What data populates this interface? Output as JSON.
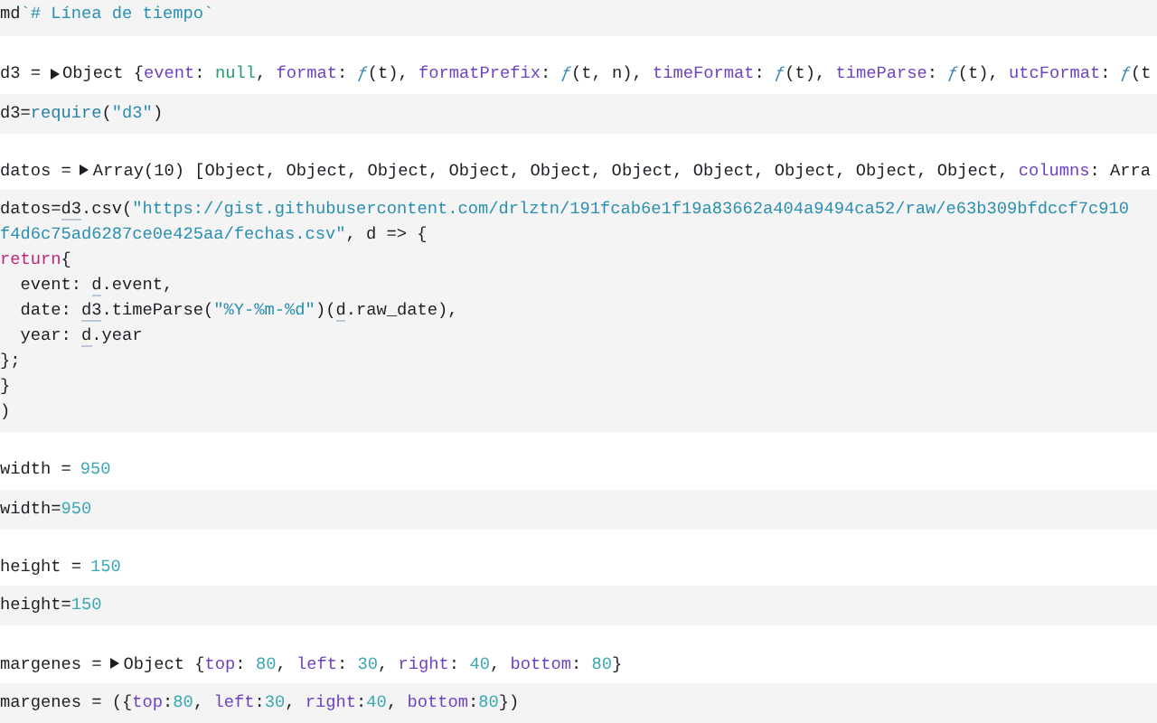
{
  "cells": [
    {
      "source": [
        [
          {
            "kind": "plain",
            "text": "md"
          },
          {
            "kind": "string",
            "text": "`# Línea de tiempo`"
          }
        ]
      ]
    },
    {
      "output": {
        "label": "d3 =",
        "expanded": false,
        "value": [
          {
            "kind": "plain",
            "text": "Object {"
          },
          {
            "kind": "property",
            "text": "event"
          },
          {
            "kind": "plain",
            "text": ": "
          },
          {
            "kind": "null",
            "text": "null"
          },
          {
            "kind": "plain",
            "text": ", "
          },
          {
            "kind": "property",
            "text": "format"
          },
          {
            "kind": "plain",
            "text": ": "
          },
          {
            "kind": "function",
            "text": "ƒ"
          },
          {
            "kind": "plain",
            "text": "(t), "
          },
          {
            "kind": "property",
            "text": "formatPrefix"
          },
          {
            "kind": "plain",
            "text": ": "
          },
          {
            "kind": "function",
            "text": "ƒ"
          },
          {
            "kind": "plain",
            "text": "(t, n), "
          },
          {
            "kind": "property",
            "text": "timeFormat"
          },
          {
            "kind": "plain",
            "text": ": "
          },
          {
            "kind": "function",
            "text": "ƒ"
          },
          {
            "kind": "plain",
            "text": "(t), "
          },
          {
            "kind": "property",
            "text": "timeParse"
          },
          {
            "kind": "plain",
            "text": ": "
          },
          {
            "kind": "function",
            "text": "ƒ"
          },
          {
            "kind": "plain",
            "text": "(t), "
          },
          {
            "kind": "property",
            "text": "utcFormat"
          },
          {
            "kind": "plain",
            "text": ": "
          },
          {
            "kind": "function",
            "text": "ƒ"
          },
          {
            "kind": "plain",
            "text": "(t"
          }
        ]
      },
      "source": [
        [
          {
            "kind": "plain",
            "text": "d3="
          },
          {
            "kind": "call",
            "text": "require"
          },
          {
            "kind": "plain",
            "text": "("
          },
          {
            "kind": "string",
            "text": "\"d3\""
          },
          {
            "kind": "plain",
            "text": ")"
          }
        ]
      ]
    },
    {
      "output": {
        "label": "datos =",
        "expanded": false,
        "value": [
          {
            "kind": "plain",
            "text": "Array(10) [Object, Object, Object, Object, Object, Object, Object, Object, Object, Object, "
          },
          {
            "kind": "property",
            "text": "columns"
          },
          {
            "kind": "plain",
            "text": ": Arra"
          }
        ]
      },
      "source": [
        [
          {
            "kind": "plain",
            "text": "datos="
          },
          {
            "kind": "reference",
            "text": "d3"
          },
          {
            "kind": "plain",
            "text": ".csv("
          },
          {
            "kind": "string",
            "text": "\"https://gist.githubusercontent.com/drlztn/191fcab6e1f19a83662a404a9494ca52/raw/e63b309bfdccf7c910"
          }
        ],
        [
          {
            "kind": "string",
            "text": "f4d6c75ad6287ce0e425aa/fechas.csv\""
          },
          {
            "kind": "plain",
            "text": ", d => {"
          }
        ],
        [
          {
            "kind": "keyword",
            "text": "return"
          },
          {
            "kind": "plain",
            "text": "{"
          }
        ],
        [
          {
            "kind": "plain",
            "text": "  event: "
          },
          {
            "kind": "reference",
            "text": "d"
          },
          {
            "kind": "plain",
            "text": ".event,"
          }
        ],
        [
          {
            "kind": "plain",
            "text": "  date: "
          },
          {
            "kind": "reference",
            "text": "d3"
          },
          {
            "kind": "plain",
            "text": ".timeParse("
          },
          {
            "kind": "string",
            "text": "\"%Y-%m-%d\""
          },
          {
            "kind": "plain",
            "text": ")("
          },
          {
            "kind": "reference",
            "text": "d"
          },
          {
            "kind": "plain",
            "text": ".raw_date),"
          }
        ],
        [
          {
            "kind": "plain",
            "text": "  year: "
          },
          {
            "kind": "reference",
            "text": "d"
          },
          {
            "kind": "plain",
            "text": ".year"
          }
        ],
        [
          {
            "kind": "plain",
            "text": "};"
          }
        ],
        [
          {
            "kind": "plain",
            "text": "}"
          }
        ],
        [
          {
            "kind": "plain",
            "text": ")"
          }
        ]
      ]
    },
    {
      "output": {
        "label": "width =",
        "value": [
          {
            "kind": "number",
            "text": "950"
          }
        ]
      },
      "source": [
        [
          {
            "kind": "plain",
            "text": "width="
          },
          {
            "kind": "number",
            "text": "950"
          }
        ]
      ]
    },
    {
      "output": {
        "label": "height =",
        "value": [
          {
            "kind": "number",
            "text": "150"
          }
        ]
      },
      "source": [
        [
          {
            "kind": "plain",
            "text": "height="
          },
          {
            "kind": "number",
            "text": "150"
          }
        ]
      ]
    },
    {
      "output": {
        "label": "margenes =",
        "expanded": false,
        "value": [
          {
            "kind": "plain",
            "text": "Object {"
          },
          {
            "kind": "property",
            "text": "top"
          },
          {
            "kind": "plain",
            "text": ": "
          },
          {
            "kind": "number",
            "text": "80"
          },
          {
            "kind": "plain",
            "text": ", "
          },
          {
            "kind": "property",
            "text": "left"
          },
          {
            "kind": "plain",
            "text": ": "
          },
          {
            "kind": "number",
            "text": "30"
          },
          {
            "kind": "plain",
            "text": ", "
          },
          {
            "kind": "property",
            "text": "right"
          },
          {
            "kind": "plain",
            "text": ": "
          },
          {
            "kind": "number",
            "text": "40"
          },
          {
            "kind": "plain",
            "text": ", "
          },
          {
            "kind": "property",
            "text": "bottom"
          },
          {
            "kind": "plain",
            "text": ": "
          },
          {
            "kind": "number",
            "text": "80"
          },
          {
            "kind": "plain",
            "text": "}"
          }
        ]
      },
      "source": [
        [
          {
            "kind": "plain",
            "text": "margenes = ({"
          },
          {
            "kind": "property",
            "text": "top"
          },
          {
            "kind": "plain",
            "text": ":"
          },
          {
            "kind": "number",
            "text": "80"
          },
          {
            "kind": "plain",
            "text": ", "
          },
          {
            "kind": "property",
            "text": "left"
          },
          {
            "kind": "plain",
            "text": ":"
          },
          {
            "kind": "number",
            "text": "30"
          },
          {
            "kind": "plain",
            "text": ", "
          },
          {
            "kind": "property",
            "text": "right"
          },
          {
            "kind": "plain",
            "text": ":"
          },
          {
            "kind": "number",
            "text": "40"
          },
          {
            "kind": "plain",
            "text": ", "
          },
          {
            "kind": "property",
            "text": "bottom"
          },
          {
            "kind": "plain",
            "text": ":"
          },
          {
            "kind": "number",
            "text": "80"
          },
          {
            "kind": "plain",
            "text": "})"
          }
        ]
      ]
    }
  ]
}
